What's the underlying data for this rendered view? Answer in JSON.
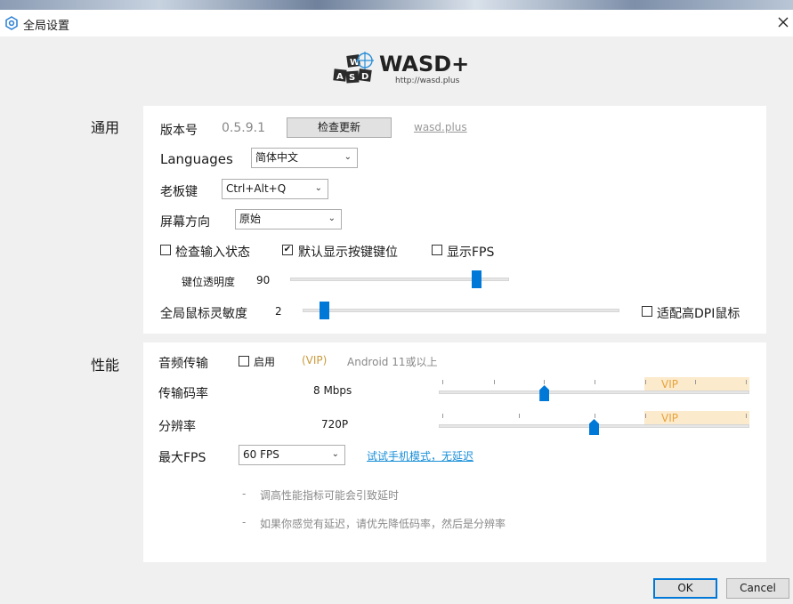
{
  "window": {
    "title": "全局设置"
  },
  "logo": {
    "name": "WASD+",
    "url": "http://wasd.plus"
  },
  "general": {
    "section_label": "通用",
    "version_label": "版本号",
    "version_value": "0.5.9.1",
    "check_update_label": "检查更新",
    "site_link": "wasd.plus",
    "languages_label": "Languages",
    "language_value": "简体中文",
    "boss_key_label": "老板键",
    "boss_key_value": "Ctrl+Alt+Q",
    "orientation_label": "屏幕方向",
    "orientation_value": "原始",
    "check_input_label": "检查输入状态",
    "check_input_checked": false,
    "show_keys_label": "默认显示按键键位",
    "show_keys_checked": true,
    "show_fps_label": "显示FPS",
    "show_fps_checked": false,
    "key_opacity_label": "键位透明度",
    "key_opacity_value": "90",
    "key_opacity_fraction": 0.85,
    "mouse_sensitivity_label": "全局鼠标灵敏度",
    "mouse_sensitivity_value": "2",
    "mouse_sensitivity_fraction": 0.07,
    "high_dpi_label": "适配高DPI鼠标",
    "high_dpi_checked": false
  },
  "performance": {
    "section_label": "性能",
    "audio_label": "音频传输",
    "audio_enable_label": "启用",
    "audio_enable_checked": false,
    "audio_vip_tag": "(VIP)",
    "audio_requirement": "Android 11或以上",
    "bitrate_label": "传输码率",
    "bitrate_value": "8 Mbps",
    "bitrate_fraction": 0.34,
    "bitrate_vip": "VIP",
    "resolution_label": "分辨率",
    "resolution_value": "720P",
    "resolution_fraction": 0.5,
    "resolution_vip": "VIP",
    "max_fps_label": "最大FPS",
    "max_fps_value": "60 FPS",
    "try_phone_link": "试试手机模式，无延迟",
    "hint_bullet": "-",
    "hint_1": "调高性能指标可能会引致延时",
    "hint_2": "如果你感觉有延迟，请优先降低码率，然后是分辨率"
  },
  "footer": {
    "ok_label": "OK",
    "cancel_label": "Cancel"
  },
  "icons": {
    "title": "settings-gear-icon",
    "close": "close-icon",
    "chevron": "chevron-down-icon",
    "check": "checkmark-icon"
  },
  "colors": {
    "accent": "#0078d7",
    "vip_bg": "#fbeacb",
    "vip_text": "#e8a33c",
    "link": "#1a8fd8"
  }
}
